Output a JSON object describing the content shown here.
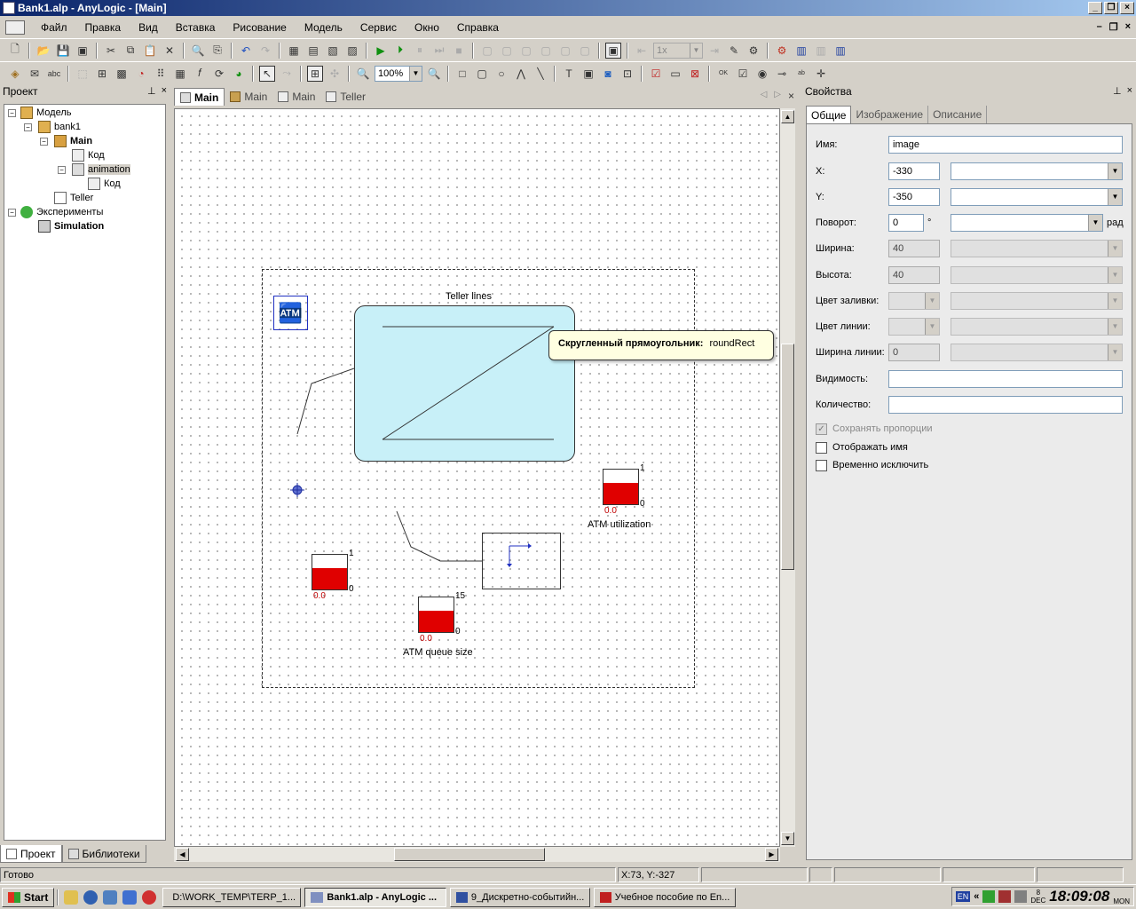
{
  "window": {
    "title": "Bank1.alp - AnyLogic - [Main]"
  },
  "menu": [
    "Файл",
    "Правка",
    "Вид",
    "Вставка",
    "Рисование",
    "Модель",
    "Сервис",
    "Окно",
    "Справка"
  ],
  "toolbar": {
    "speed": "1x",
    "zoom": "100%"
  },
  "project_panel": {
    "title": "Проект",
    "tree": {
      "model": "Модель",
      "bank1": "bank1",
      "main": "Main",
      "kod1": "Код",
      "animation": "animation",
      "kod2": "Код",
      "teller": "Teller",
      "experiments": "Эксперименты",
      "simulation": "Simulation"
    },
    "tabs": [
      "Проект",
      "Библиотеки"
    ]
  },
  "editor": {
    "tabs": [
      "Main",
      "Main",
      "Main",
      "Teller"
    ],
    "canvas": {
      "teller_lines": "Teller lines",
      "atm_utilization": "ATM utilization",
      "atm_queue_size": "ATM queue size",
      "ind_util": {
        "max": "1",
        "min": "0",
        "value": "0.0",
        "fill": 0.62
      },
      "ind_left": {
        "max": "1",
        "min": "0",
        "value": "0.0",
        "fill": 0.62
      },
      "ind_queue": {
        "max": "15",
        "min": "0",
        "value": "0.0",
        "fill": 0.62
      },
      "tooltip_label": "Скругленный прямоугольник:",
      "tooltip_value": "roundRect"
    }
  },
  "properties": {
    "title": "Свойства",
    "tabs": [
      "Общие",
      "Изображение",
      "Описание"
    ],
    "name_label": "Имя:",
    "name_value": "image",
    "x_label": "X:",
    "x_value": "-330",
    "y_label": "Y:",
    "y_value": "-350",
    "rot_label": "Поворот:",
    "rot_value": "0",
    "rot_unit": "°",
    "rad_label": "рад",
    "width_label": "Ширина:",
    "width_value": "40",
    "height_label": "Высота:",
    "height_value": "40",
    "fill_label": "Цвет заливки:",
    "line_color_label": "Цвет линии:",
    "line_width_label": "Ширина линии:",
    "line_width_value": "0",
    "visibility_label": "Видимость:",
    "count_label": "Количество:",
    "keep_ratio": "Сохранять пропорции",
    "show_name": "Отображать имя",
    "exclude": "Временно исключить"
  },
  "status": {
    "ready": "Готово",
    "coords": "X:73, Y:-327"
  },
  "taskbar": {
    "start": "Start",
    "tasks": [
      "D:\\WORK_TEMP\\TERP_1...",
      "Bank1.alp - AnyLogic ...",
      "9_Дискретно-событийн...",
      "Учебное пособие по En..."
    ],
    "lang": "EN",
    "date_day": "8",
    "date_month": "DEC",
    "time": "18:09:08",
    "weekday": "MON"
  }
}
